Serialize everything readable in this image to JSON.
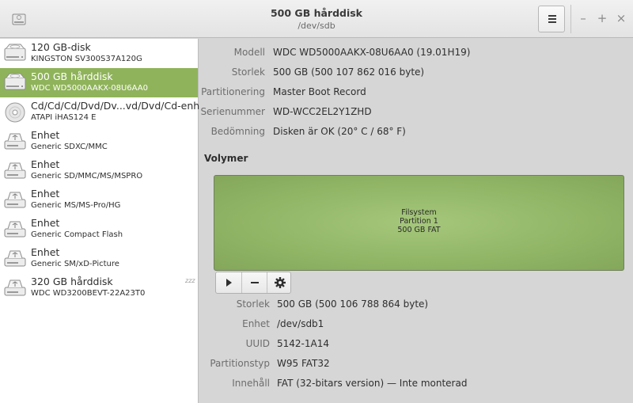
{
  "window": {
    "title": "500 GB hårddisk",
    "subtitle": "/dev/sdb",
    "controls": {
      "minimize": "–",
      "maximize": "+",
      "close": "×"
    }
  },
  "devices": [
    {
      "name": "120 GB-disk",
      "model": "KINGSTON SV300S37A120G",
      "icon": "hard-disk-icon",
      "selected": false
    },
    {
      "name": "500 GB hårddisk",
      "model": "WDC WD5000AAKX-08U6AA0",
      "icon": "hard-disk-icon",
      "selected": true
    },
    {
      "name": "Cd/Cd/Cd/Dvd/Dv...vd/Dvd/Cd-enhet",
      "model": "ATAPI   iHAS124   E",
      "icon": "optical-disc-icon",
      "selected": false
    },
    {
      "name": "Enhet",
      "model": "Generic SDXC/MMC",
      "icon": "usb-drive-icon",
      "selected": false
    },
    {
      "name": "Enhet",
      "model": "Generic SD/MMC/MS/MSPRO",
      "icon": "usb-drive-icon",
      "selected": false
    },
    {
      "name": "Enhet",
      "model": "Generic MS/MS-Pro/HG",
      "icon": "usb-drive-icon",
      "selected": false
    },
    {
      "name": "Enhet",
      "model": "Generic Compact Flash",
      "icon": "usb-drive-icon",
      "selected": false
    },
    {
      "name": "Enhet",
      "model": "Generic SM/xD-Picture",
      "icon": "usb-drive-icon",
      "selected": false
    },
    {
      "name": "320 GB hårddisk",
      "model": "WDC WD3200BEVT-22A23T0",
      "icon": "usb-drive-icon",
      "selected": false,
      "standby": "zzz"
    }
  ],
  "disk_info": [
    {
      "label": "Modell",
      "value": "WDC WD5000AAKX-08U6AA0 (19.01H19)"
    },
    {
      "label": "Storlek",
      "value": "500 GB (500 107 862 016 byte)"
    },
    {
      "label": "Partitionering",
      "value": "Master Boot Record"
    },
    {
      "label": "Serienummer",
      "value": "WD-WCC2EL2Y1ZHD"
    },
    {
      "label": "Bedömning",
      "value": "Disken är OK (20° C / 68° F)"
    }
  ],
  "volumes": {
    "title": "Volymer",
    "partition": {
      "line1": "Filsystem",
      "line2": "Partition 1",
      "line3": "500 GB FAT"
    },
    "color": "#90b565",
    "toolbar": [
      "play-icon",
      "minus-icon",
      "gear-icon"
    ]
  },
  "volume_info": [
    {
      "label": "Storlek",
      "value": "500 GB (500 106 788 864 byte)"
    },
    {
      "label": "Enhet",
      "value": "/dev/sdb1"
    },
    {
      "label": "UUID",
      "value": "5142-1A14"
    },
    {
      "label": "Partitionstyp",
      "value": "W95 FAT32"
    },
    {
      "label": "Innehåll",
      "value": "FAT (32-bitars version) — Inte monterad"
    }
  ]
}
